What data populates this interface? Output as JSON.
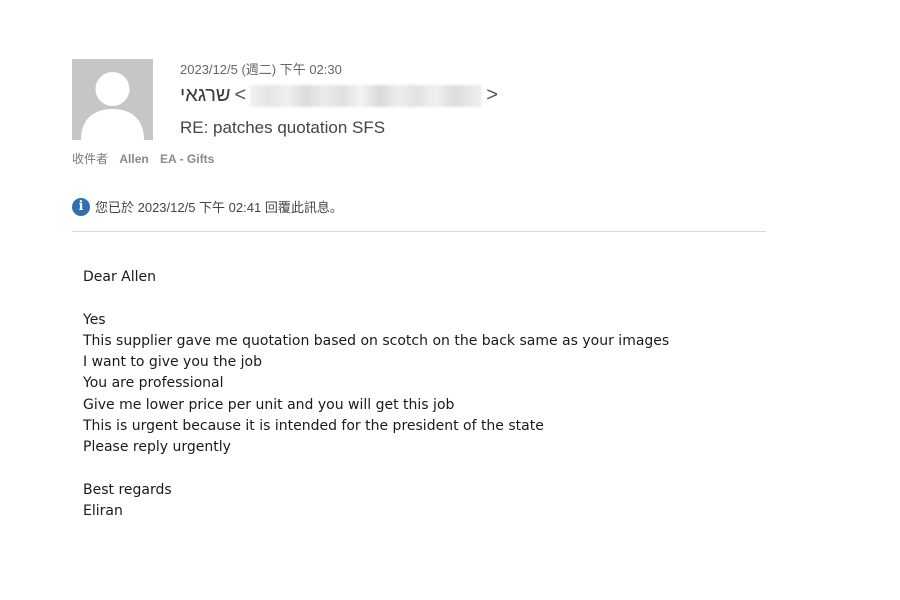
{
  "email": {
    "date": "2023/12/5 (週二) 下午 02:30",
    "sender_name": "שרגאי",
    "sender_open": "<",
    "sender_close": ">",
    "subject": "RE: patches quotation SFS",
    "recipients_label": "收件者",
    "recipients": [
      "Allen",
      "EA - Gifts"
    ],
    "info_icon": "info-icon",
    "info_message": "您已於 2023/12/5 下午 02:41 回覆此訊息。",
    "body": {
      "greeting": "Dear Allen",
      "lines": [
        "Yes",
        "This supplier gave me quotation based on scotch on the back same as your images",
        "I want to give you the job",
        "You are professional",
        "Give me lower price per unit and you will get this job",
        "This is urgent because it is intended for the president of the state",
        "Please reply urgently"
      ],
      "closing": "Best regards",
      "signature": "Eliran"
    }
  },
  "colors": {
    "avatar_bg": "#c6c6c6",
    "info_icon": "#2f6fb4",
    "divider": "#d8d8d8"
  }
}
